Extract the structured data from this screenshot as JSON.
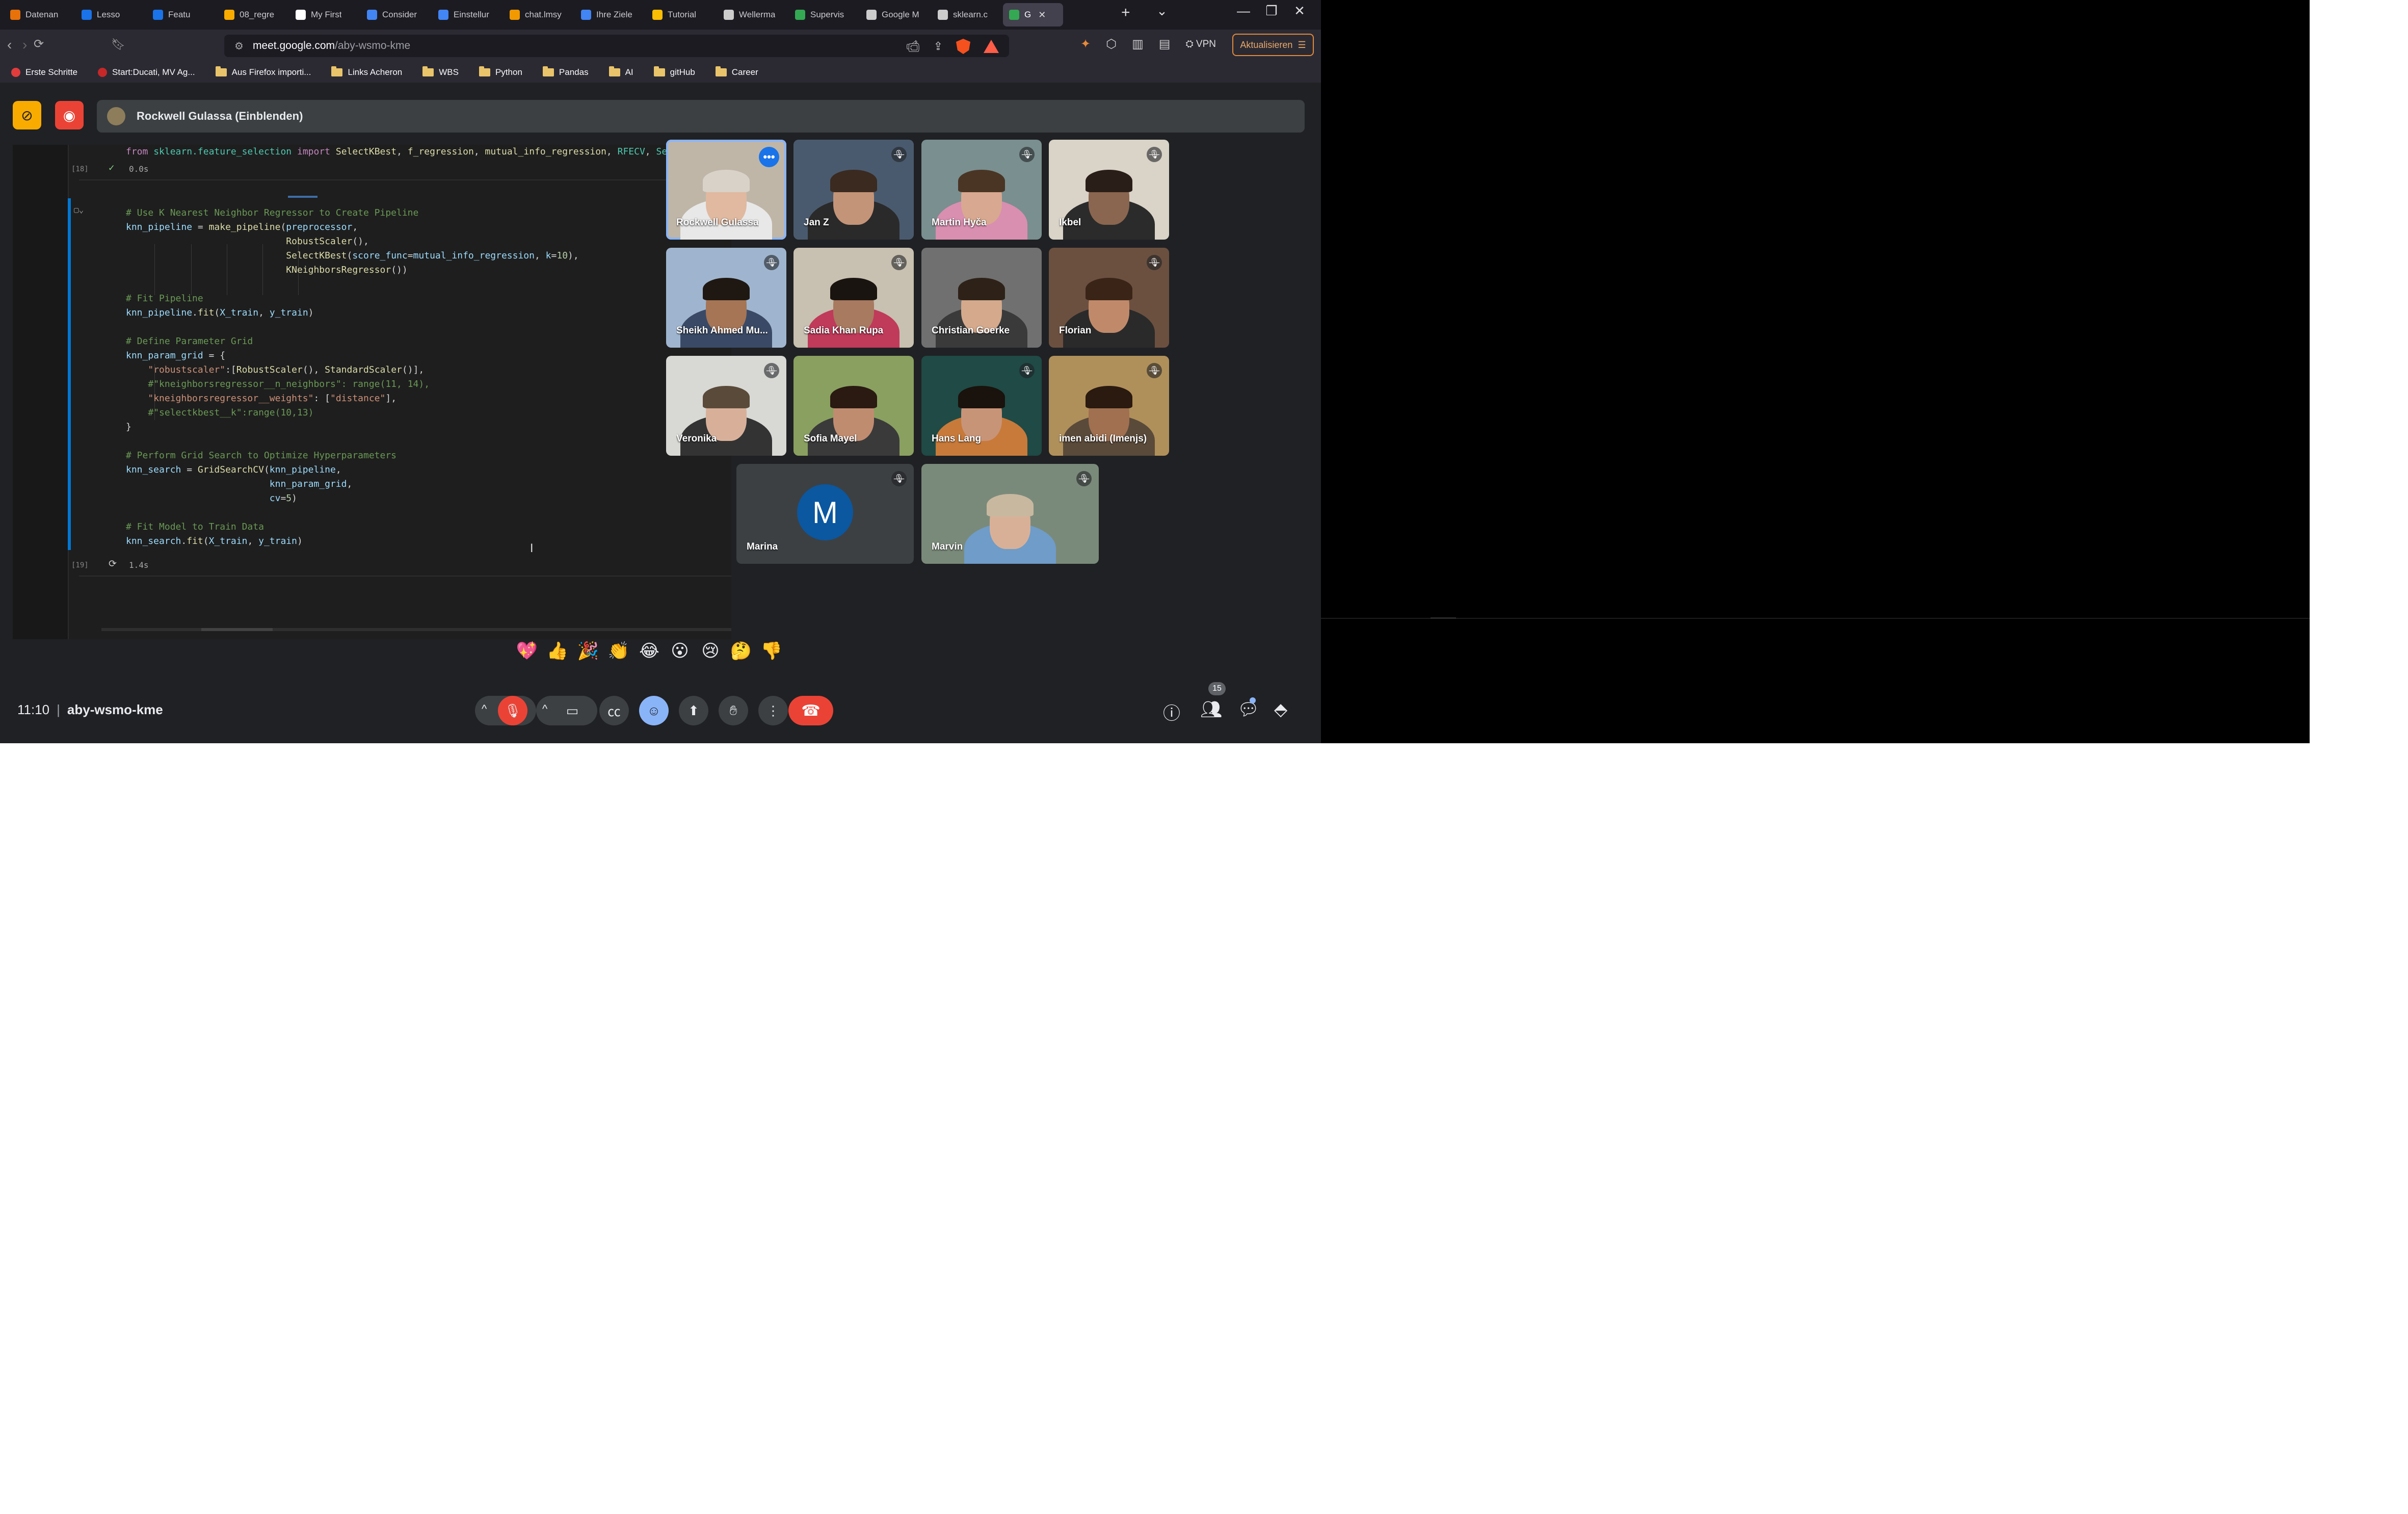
{
  "browser": {
    "tabs": [
      {
        "label": "Datenan",
        "color": "#e8710a",
        "icon": "table-icon"
      },
      {
        "label": "Lesso",
        "color": "#1a73e8",
        "icon": "course-icon"
      },
      {
        "label": "Featu",
        "color": "#1a73e8",
        "icon": "doc-icon"
      },
      {
        "label": "08_regre",
        "color": "#f9ab00",
        "icon": "colab-icon"
      },
      {
        "label": "My First",
        "color": "#ffffff",
        "icon": "medium-icon"
      },
      {
        "label": "Consider",
        "color": "#4285f4",
        "icon": "video-icon"
      },
      {
        "label": "Einstellur",
        "color": "#4285f4",
        "icon": "video-icon"
      },
      {
        "label": "chat.lmsy",
        "color": "#f29900",
        "icon": "chat-icon"
      },
      {
        "label": "Ihre Ziele",
        "color": "#4285f4",
        "icon": "video-icon"
      },
      {
        "label": "Tutorial",
        "color": "#fbbc04",
        "icon": "grid-icon"
      },
      {
        "label": "Wellerma",
        "color": "#cccccc",
        "icon": "globe-icon"
      },
      {
        "label": "Supervis",
        "color": "#34a853",
        "icon": "book-icon"
      },
      {
        "label": "Google M",
        "color": "#cccccc",
        "icon": "google-icon"
      },
      {
        "label": "sklearn.c",
        "color": "#cccccc",
        "icon": "sklearn-icon"
      },
      {
        "label": "G",
        "color": "#34a853",
        "icon": "meet-icon",
        "active": true
      }
    ],
    "url_host": "meet.google.com",
    "url_path": "/aby-wsmo-kme",
    "vpn_label": "VPN",
    "update_label": "Aktualisieren",
    "bookmarks": [
      {
        "label": "Erste Schritte",
        "type": "site"
      },
      {
        "label": "Start:Ducati, MV Ag...",
        "type": "site"
      },
      {
        "label": "Aus Firefox importi...",
        "type": "folder"
      },
      {
        "label": "Links Acheron",
        "type": "folder"
      },
      {
        "label": "WBS",
        "type": "folder"
      },
      {
        "label": "Python",
        "type": "folder"
      },
      {
        "label": "Pandas",
        "type": "folder"
      },
      {
        "label": "AI",
        "type": "folder"
      },
      {
        "label": "gitHub",
        "type": "folder"
      },
      {
        "label": "Career",
        "type": "folder"
      }
    ]
  },
  "meet": {
    "presenter_bar": "Rockwell Gulassa (Einblenden)",
    "clock": "11:10",
    "meeting_code": "aby-wsmo-kme",
    "participant_count": "15",
    "reactions": [
      "💖",
      "👍",
      "🎉",
      "👏",
      "😂",
      "😮",
      "😢",
      "🤔",
      "👎"
    ],
    "participants": [
      {
        "name": "Rockwell Gulassa",
        "muted": false,
        "speaking": true,
        "bg": "#bfb6a8",
        "skin": "#e0b9a0",
        "shirt": "#e8e8e8",
        "hair": "#d9d2c8"
      },
      {
        "name": "Jan Z",
        "muted": true,
        "bg": "#4a5a6e",
        "skin": "#c49478",
        "shirt": "#2a2a2a",
        "hair": "#3a2a20"
      },
      {
        "name": "Martin Hyča",
        "muted": true,
        "bg": "#7a8f8f",
        "skin": "#d8a890",
        "shirt": "#d98fb0",
        "hair": "#4a3525"
      },
      {
        "name": "Ikbel",
        "muted": true,
        "bg": "#d9d3c8",
        "skin": "#8a6650",
        "shirt": "#2b2b2b",
        "hair": "#2a1f18"
      },
      {
        "name": "Sheikh Ahmed Mu...",
        "muted": true,
        "bg": "#9fb5cf",
        "skin": "#a57555",
        "shirt": "#3a4a66",
        "hair": "#1f1812"
      },
      {
        "name": "Sadia Khan Rupa",
        "muted": true,
        "bg": "#c8c0b0",
        "skin": "#a87a60",
        "shirt": "#c03a5a",
        "hair": "#1a1410"
      },
      {
        "name": "Christian Goerke",
        "muted": false,
        "bg": "#707070",
        "skin": "#d4a98c",
        "shirt": "#3a3a3a",
        "hair": "#2e2218"
      },
      {
        "name": "Florian",
        "muted": true,
        "bg": "#6b5040",
        "skin": "#c08a6a",
        "shirt": "#2a2a2a",
        "hair": "#3a2418"
      },
      {
        "name": "Veronika",
        "muted": true,
        "bg": "#d8d8d4",
        "skin": "#d8b09a",
        "shirt": "#333333",
        "hair": "#5a4a3a"
      },
      {
        "name": "Sofia Mayel",
        "muted": false,
        "bg": "#8aa060",
        "skin": "#c08c70",
        "shirt": "#3a3a3a",
        "hair": "#2a1a12"
      },
      {
        "name": "Hans Lang",
        "muted": true,
        "bg": "#1f4a46",
        "skin": "#c89478",
        "shirt": "#c87a3a",
        "hair": "#1a120c"
      },
      {
        "name": "imen abidi (Imenjs)",
        "muted": true,
        "bg": "#b0905a",
        "skin": "#a07050",
        "shirt": "#5a4a3a",
        "hair": "#2a1a10"
      },
      {
        "name": "Marina",
        "muted": true,
        "avatar": "M",
        "bg": "#3c4043"
      },
      {
        "name": "Marvin",
        "muted": true,
        "bg": "#7a8a7a",
        "skin": "#d8b098",
        "shirt": "#6f9cc8",
        "hair": "#c8b8a0"
      }
    ]
  },
  "notebook": {
    "cell1": {
      "number": "[18]",
      "timing": "0.0s",
      "code_line": "from sklearn.feature_selection import SelectKBest, f_regression, mutual_info_regression, RFECV, Select"
    },
    "cell2": {
      "number": "[19]",
      "timing": "1.4s",
      "lines": [
        "# Use K Nearest Neighbor Regressor to Create Pipeline",
        "knn_pipeline = make_pipeline(preprocessor,",
        "                             RobustScaler(),",
        "                             SelectKBest(score_func=mutual_info_regression, k=10),",
        "                             KNeighborsRegressor())",
        "",
        "# Fit Pipeline",
        "knn_pipeline.fit(X_train, y_train)",
        "",
        "# Define Parameter Grid",
        "knn_param_grid = {",
        "    \"robustscaler\":[RobustScaler(), StandardScaler()],",
        "    #\"kneighborsregressor__n_neighbors\": range(11, 14),",
        "    \"kneighborsregressor__weights\": [\"distance\"],",
        "    #\"selectkbest__k\":range(10,13)",
        "}",
        "",
        "# Perform Grid Search to Optimize Hyperparameters",
        "knn_search = GridSearchCV(knn_pipeline,",
        "                          knn_param_grid,",
        "                          cv=5)",
        "",
        "# Fit Model to Train Data",
        "knn_search.fit(X_train, y_train)"
      ]
    }
  }
}
